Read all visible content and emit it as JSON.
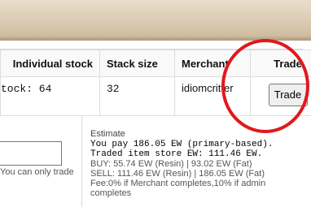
{
  "table": {
    "headers": {
      "individual_stock": "Individual stock",
      "stack_size": "Stack size",
      "merchant": "Merchant",
      "trade": "Trade"
    },
    "row": {
      "individual_stock": "tock: 64",
      "stack_size": "32",
      "merchant": "idiomcritter",
      "trade_button": "Trade"
    }
  },
  "form": {
    "quantity_value": "",
    "hint": "You can only trade"
  },
  "estimate": {
    "label": "Estimate",
    "you_pay": "You pay 186.05 EW (primary-based).",
    "traded_item_store": "Traded item store EW: 111.46 EW.",
    "buy": "BUY: 55.74 EW (Resin) | 93.02 EW (Fat)",
    "sell": "SELL: 111.46 EW (Resin) | 186.05 EW (Fat)",
    "fee": "Fee:0% if Merchant completes,10% if admin",
    "fee_cont": "completes"
  },
  "colors": {
    "highlight_circle": "#e0191d",
    "header_bg": "#f9f9f9",
    "banner": "#d6c4aa"
  }
}
